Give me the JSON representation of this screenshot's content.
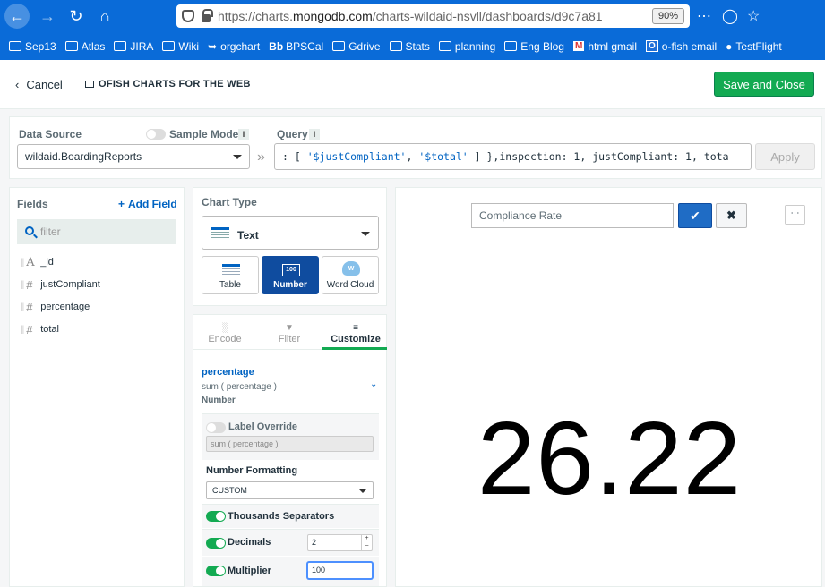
{
  "browser": {
    "url_prefix": "https://charts.",
    "url_domain": "mongodb.com",
    "url_rest": "/charts-wildaid-nsvll/dashboards/d9c7a81",
    "zoom": "90%",
    "bookmarks": [
      {
        "label": "Sep13",
        "icon": "folder-icon"
      },
      {
        "label": "Atlas",
        "icon": "folder-icon"
      },
      {
        "label": "JIRA",
        "icon": "folder-icon"
      },
      {
        "label": "Wiki",
        "icon": "folder-icon"
      },
      {
        "label": "orgchart",
        "icon": "orgchart-icon"
      },
      {
        "label": "BPSCal",
        "icon": "bb-icon",
        "prefix": "Bb"
      },
      {
        "label": "Gdrive",
        "icon": "folder-icon"
      },
      {
        "label": "Stats",
        "icon": "folder-icon"
      },
      {
        "label": "planning",
        "icon": "folder-icon"
      },
      {
        "label": "Eng Blog",
        "icon": "folder-icon"
      },
      {
        "label": "html gmail",
        "icon": "gmail-icon",
        "prefix": "M"
      },
      {
        "label": "o-fish email",
        "icon": "outlook-icon",
        "prefix": "O"
      },
      {
        "label": "TestFlight",
        "icon": "apple-icon"
      }
    ]
  },
  "header": {
    "cancel_label": "Cancel",
    "dashboard_title": "OFISH CHARTS FOR THE WEB",
    "save_label": "Save and Close"
  },
  "data_source": {
    "label": "Data Source",
    "value": "wildaid.BoardingReports",
    "sample_mode_label": "Sample Mode",
    "sample_mode_on": false,
    "query_label": "Query",
    "query_pre": ": [ ",
    "query_s1": "'$justCompliant'",
    "query_mid": ", ",
    "query_s2": "'$total'",
    "query_post": " ] },inspection: 1, justCompliant: 1, tota",
    "apply_label": "Apply"
  },
  "fields": {
    "title": "Fields",
    "add_label": "Add Field",
    "filter_placeholder": "filter",
    "items": [
      {
        "name": "_id",
        "type": "A"
      },
      {
        "name": "justCompliant",
        "type": "#"
      },
      {
        "name": "percentage",
        "type": "#"
      },
      {
        "name": "total",
        "type": "#"
      }
    ]
  },
  "chart_type": {
    "label": "Chart Type",
    "selected": "Text",
    "options": [
      {
        "label": "Table"
      },
      {
        "label": "Number",
        "icon_text": "100"
      },
      {
        "label": "Word Cloud",
        "icon_text": "W"
      }
    ]
  },
  "tabs": {
    "encode": "Encode",
    "filter": "Filter",
    "customize": "Customize"
  },
  "customize": {
    "field": "percentage",
    "aggregation": "sum ( percentage )",
    "type": "Number",
    "label_override_label": "Label Override",
    "label_override_on": false,
    "label_override_placeholder": "sum ( percentage )",
    "number_formatting_label": "Number Formatting",
    "number_formatting_value": "CUSTOM",
    "thousands_label": "Thousands Separators",
    "thousands_on": true,
    "decimals_label": "Decimals",
    "decimals_on": true,
    "decimals_value": "2",
    "multiplier_label": "Multiplier",
    "multiplier_on": true,
    "multiplier_value": "100"
  },
  "canvas": {
    "title_value": "Compliance Rate",
    "big_number": "26.22"
  }
}
